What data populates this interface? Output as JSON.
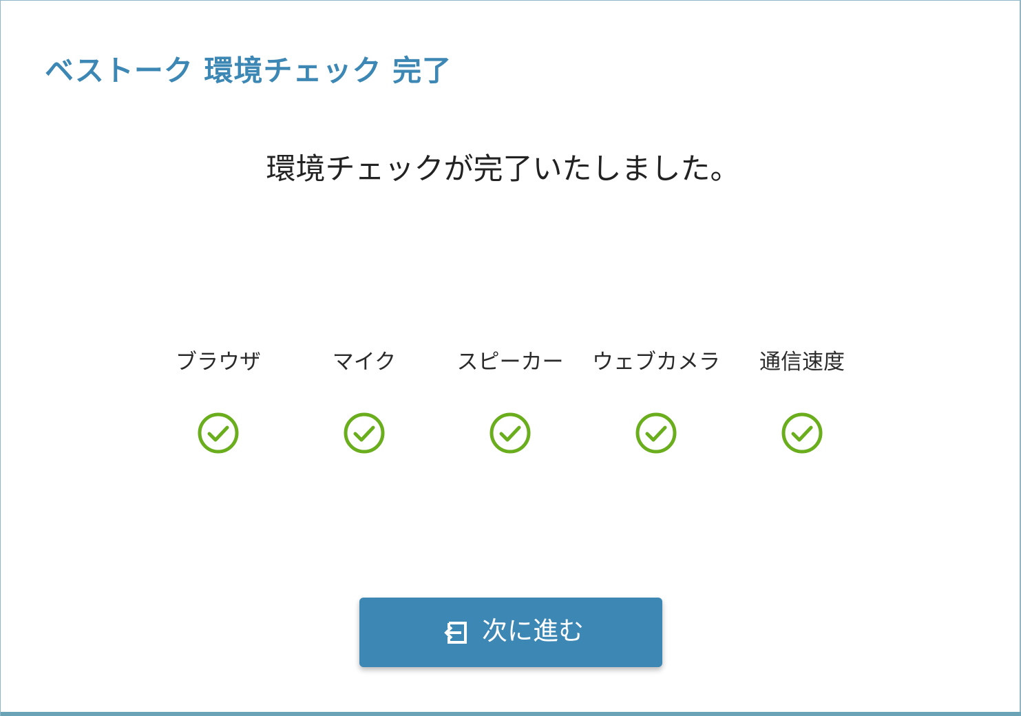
{
  "header": {
    "title": "ベストーク 環境チェック 完了"
  },
  "main": {
    "message": "環境チェックが完了いたしました。",
    "checks": [
      {
        "label": "ブラウザ",
        "status": "ok",
        "icon": "check-circle-icon"
      },
      {
        "label": "マイク",
        "status": "ok",
        "icon": "check-circle-icon"
      },
      {
        "label": "スピーカー",
        "status": "ok",
        "icon": "check-circle-icon"
      },
      {
        "label": "ウェブカメラ",
        "status": "ok",
        "icon": "check-circle-icon"
      },
      {
        "label": "通信速度",
        "status": "ok",
        "icon": "check-circle-icon"
      }
    ],
    "next_button": {
      "label": "次に進む",
      "icon": "login-arrow-icon"
    }
  },
  "colors": {
    "accent": "#3d87b4",
    "success": "#6aae1e",
    "text": "#222222",
    "background": "#ffffff"
  }
}
